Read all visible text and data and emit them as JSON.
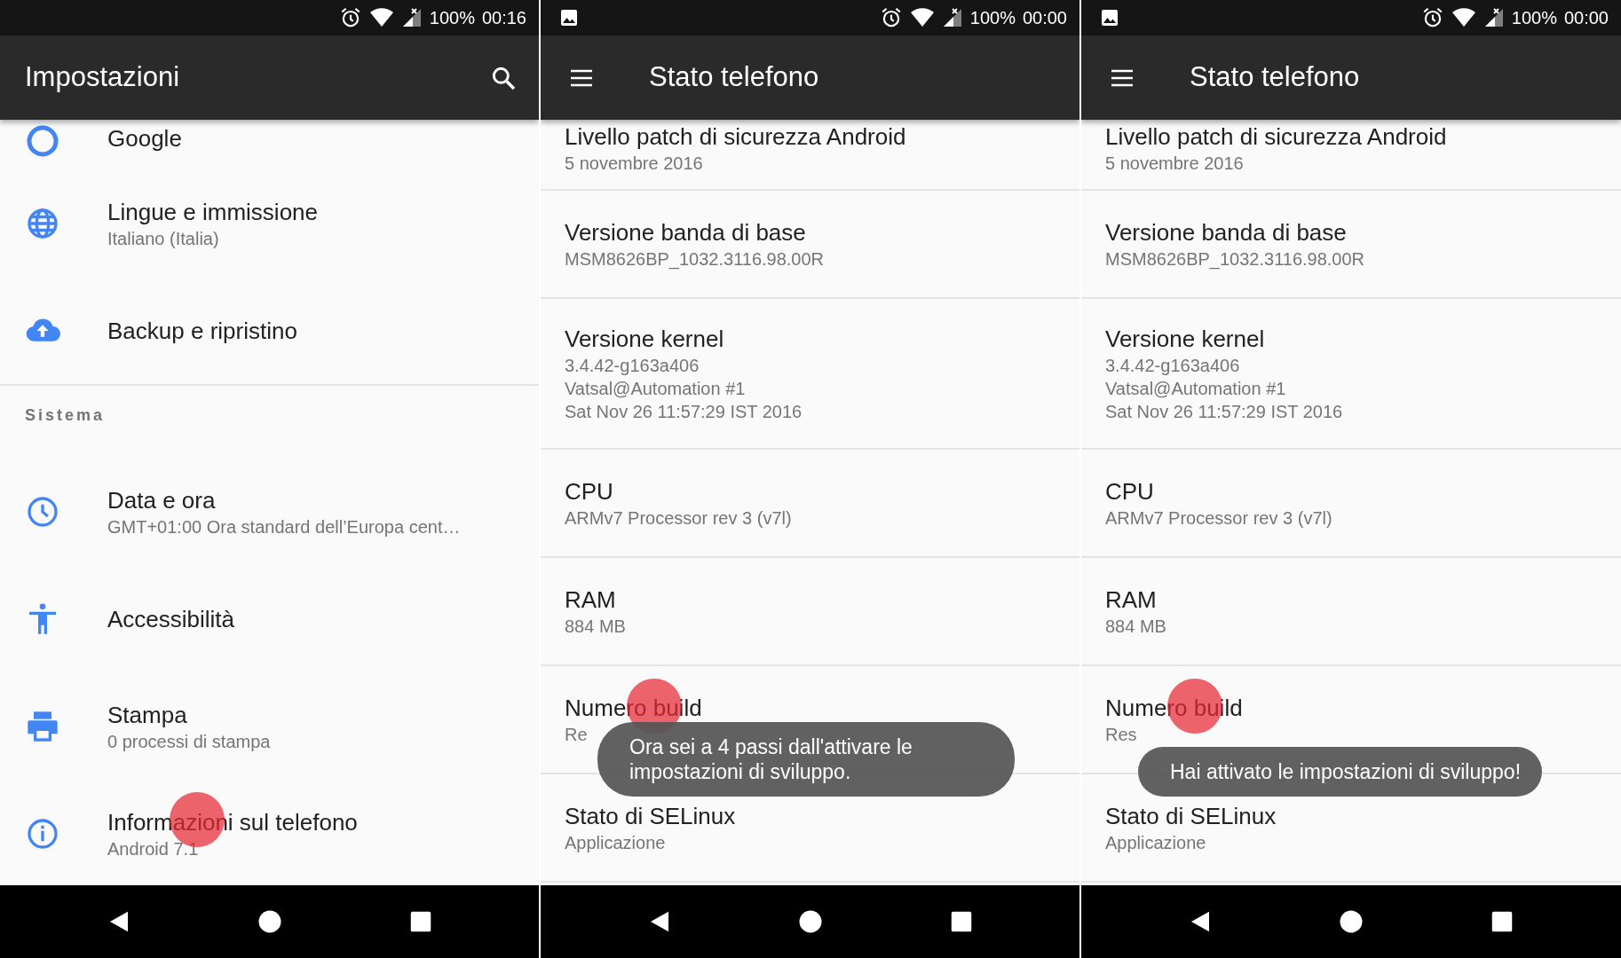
{
  "screens": [
    {
      "kind": "settings",
      "status_bar": {
        "picture_notification": false,
        "battery": "100%",
        "time": "00:16"
      },
      "title": "Impostazioni",
      "items": [
        {
          "kind": "item",
          "title": "Google",
          "touched": false
        },
        {
          "kind": "item",
          "title": "Lingue e immissione",
          "subtitle": [
            "Italiano (Italia)"
          ],
          "touched": false
        },
        {
          "kind": "item",
          "title": "Backup e ripristino",
          "touched": false
        },
        {
          "kind": "section",
          "title": "Sistema"
        },
        {
          "kind": "item",
          "title": "Data e ora",
          "subtitle": [
            "GMT+01:00 Ora standard dell’Europa cent…"
          ],
          "touched": false
        },
        {
          "kind": "item",
          "title": "Accessibilità",
          "touched": false
        },
        {
          "kind": "item",
          "title": "Stampa",
          "subtitle": [
            "0 processi di stampa"
          ],
          "touched": false
        },
        {
          "kind": "item",
          "title": "Informazioni sul telefono",
          "subtitle": [
            "Android 7.1"
          ],
          "touched": true
        }
      ]
    },
    {
      "kind": "status",
      "status_bar": {
        "picture_notification": true,
        "battery": "100%",
        "time": "00:00"
      },
      "title": "Stato telefono",
      "toast": "Ora sei a 4 passi dall'attivare le impostazioni di sviluppo.",
      "items": [
        {
          "kind": "item",
          "title": "Livello patch di sicurezza Android",
          "subtitle": [
            "5 novembre 2016"
          ],
          "touched": false
        },
        {
          "kind": "item",
          "title": "Versione banda di base",
          "subtitle": [
            "MSM8626BP_1032.3116.98.00R"
          ],
          "touched": false
        },
        {
          "kind": "item",
          "title": "Versione kernel",
          "subtitle": [
            "3.4.42-g163a406",
            "Vatsal@Automation #1",
            "Sat Nov 26 11:57:29 IST 2016"
          ],
          "touched": false
        },
        {
          "kind": "item",
          "title": "CPU",
          "subtitle": [
            "ARMv7 Processor rev 3 (v7l)"
          ],
          "touched": false
        },
        {
          "kind": "item",
          "title": "RAM",
          "subtitle": [
            "884 MB"
          ],
          "touched": false
        },
        {
          "kind": "item",
          "title": "Numero build",
          "subtitle": [
            "Re"
          ],
          "touched": true
        },
        {
          "kind": "item",
          "title": "Stato di SELinux",
          "subtitle": [
            "Applicazione"
          ],
          "touched": false
        }
      ]
    },
    {
      "kind": "status",
      "status_bar": {
        "picture_notification": true,
        "battery": "100%",
        "time": "00:00"
      },
      "title": "Stato telefono",
      "toast": "Hai attivato le impostazioni di sviluppo!",
      "items": [
        {
          "kind": "item",
          "title": "Livello patch di sicurezza Android",
          "subtitle": [
            "5 novembre 2016"
          ],
          "touched": false
        },
        {
          "kind": "item",
          "title": "Versione banda di base",
          "subtitle": [
            "MSM8626BP_1032.3116.98.00R"
          ],
          "touched": false
        },
        {
          "kind": "item",
          "title": "Versione kernel",
          "subtitle": [
            "3.4.42-g163a406",
            "Vatsal@Automation #1",
            "Sat Nov 26 11:57:29 IST 2016"
          ],
          "touched": false
        },
        {
          "kind": "item",
          "title": "CPU",
          "subtitle": [
            "ARMv7 Processor rev 3 (v7l)"
          ],
          "touched": false
        },
        {
          "kind": "item",
          "title": "RAM",
          "subtitle": [
            "884 MB"
          ],
          "touched": false
        },
        {
          "kind": "item",
          "title": "Numero build",
          "subtitle": [
            "Res"
          ],
          "touched": true
        },
        {
          "kind": "item",
          "title": "Stato di SELinux",
          "subtitle": [
            "Applicazione"
          ],
          "touched": false
        }
      ]
    }
  ]
}
